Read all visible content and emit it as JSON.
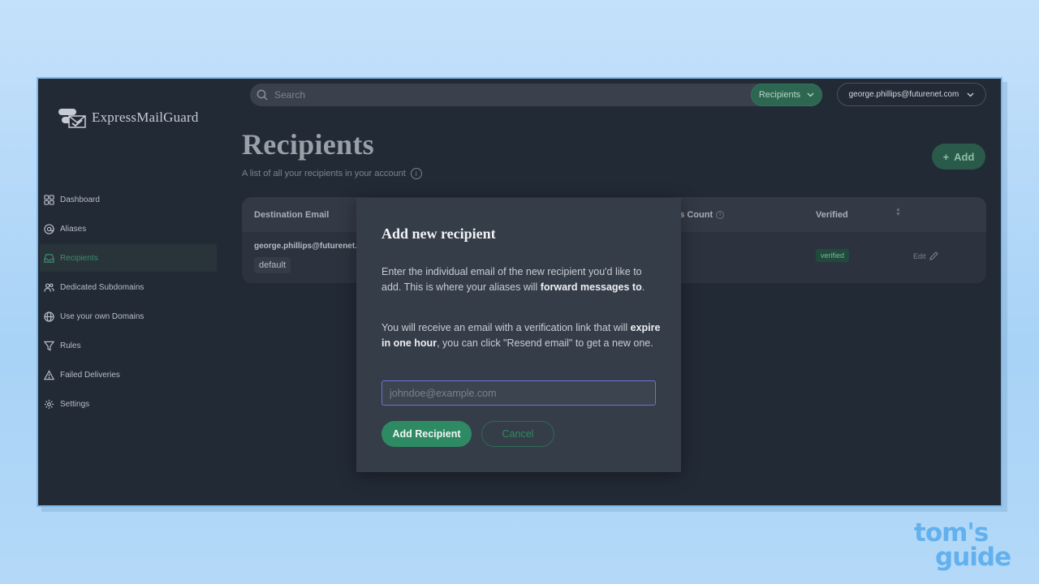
{
  "brand": {
    "name": "ExpressMailGuard"
  },
  "sidebar": {
    "items": [
      {
        "label": "Dashboard",
        "icon": "grid-icon"
      },
      {
        "label": "Aliases",
        "icon": "at-icon"
      },
      {
        "label": "Recipients",
        "icon": "inbox-icon",
        "active": true
      },
      {
        "label": "Dedicated Subdomains",
        "icon": "users-icon"
      },
      {
        "label": "Use your own Domains",
        "icon": "globe-icon"
      },
      {
        "label": "Rules",
        "icon": "filter-icon"
      },
      {
        "label": "Failed Deliveries",
        "icon": "warning-icon"
      },
      {
        "label": "Settings",
        "icon": "gear-icon"
      }
    ]
  },
  "topbar": {
    "search_placeholder": "Search",
    "scope_label": "Recipients",
    "account_email": "george.phillips@futurenet.com"
  },
  "page": {
    "title": "Recipients",
    "subtitle": "A list of all your recipients in your account",
    "add_label": "Add"
  },
  "table": {
    "headers": {
      "email": "Destination Email",
      "count": "ias Count",
      "verified": "Verified"
    },
    "rows": [
      {
        "email": "george.phillips@futurenet.c",
        "badge": "default",
        "verified": "verified",
        "edit": "Edit"
      }
    ]
  },
  "modal": {
    "title": "Add new recipient",
    "p1_pre": "Enter the individual email of the new recipient you'd like to add. This is where your aliases will ",
    "p1_bold": "forward messages to",
    "p1_post": ".",
    "p2_pre": "You will receive an email with a verification link that will ",
    "p2_bold": "expire in one hour",
    "p2_post": ", you can click \"Resend email\" to get a new one.",
    "input_placeholder": "johndoe@example.com",
    "submit_label": "Add Recipient",
    "cancel_label": "Cancel"
  },
  "watermark": {
    "line1": "tom's",
    "line2": "guide"
  },
  "colors": {
    "accent": "#2e8a63",
    "background": "#222a36",
    "modal": "#353d49",
    "focus": "#6a74d8"
  }
}
